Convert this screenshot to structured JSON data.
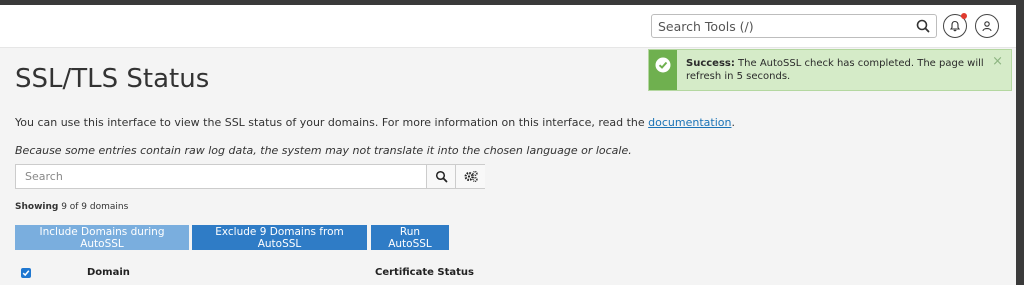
{
  "header": {
    "search_placeholder": "Search Tools (/)"
  },
  "page": {
    "title": "SSL/TLS Status",
    "intro_text": "You can use this interface to view the SSL status of your domains. For more information on this interface, read the ",
    "intro_link": "documentation",
    "intro_end": ".",
    "note": "Because some entries contain raw log data, the system may not translate it into the chosen language or locale."
  },
  "search": {
    "placeholder": "Search"
  },
  "showing": {
    "label": "Showing",
    "text": " 9 of 9 domains"
  },
  "buttons": {
    "include": "Include Domains during AutoSSL",
    "exclude": "Exclude 9 Domains from AutoSSL",
    "run": "Run AutoSSL"
  },
  "table": {
    "columns": [
      "Domain",
      "Certificate Status"
    ],
    "select_all_checked": true
  },
  "alert": {
    "strong": "Success:",
    "message": " The AutoSSL check has completed. The page will refresh in 5 seconds.",
    "close": "×"
  },
  "colors": {
    "primary": "#2f7cc6",
    "primary_light": "#7aaede",
    "success_bg": "#d5ebc8",
    "success_icon": "#6fb04f",
    "link": "#1a73b6",
    "notification_dot": "#e03a2e"
  },
  "icons": [
    "search-icon",
    "bell-icon",
    "user-icon",
    "gears-icon",
    "check-circle-icon",
    "close-icon",
    "checkbox-icon"
  ]
}
